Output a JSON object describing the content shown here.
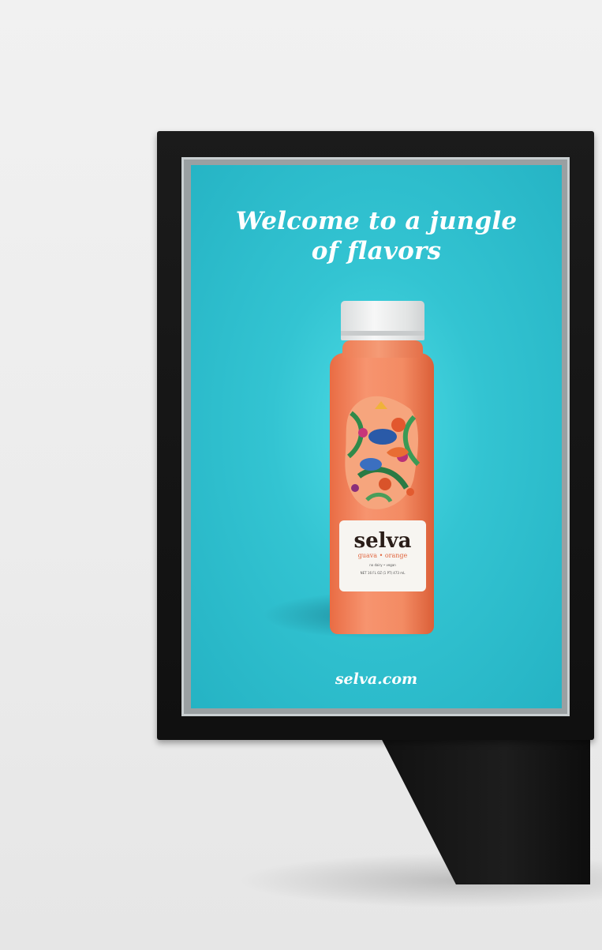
{
  "poster": {
    "headline_line1": "Welcome to a jungle",
    "headline_line2": "of flavors",
    "website": "selva.com",
    "background_color": "#33c4d2"
  },
  "bottle": {
    "brand": "selva",
    "flavor": "guava • orange",
    "fine_print_1": "no dairy • vegan",
    "fine_print_2": "NET 16 FL OZ (1 PT) 473 mL",
    "juice_color": "#f38b63"
  }
}
